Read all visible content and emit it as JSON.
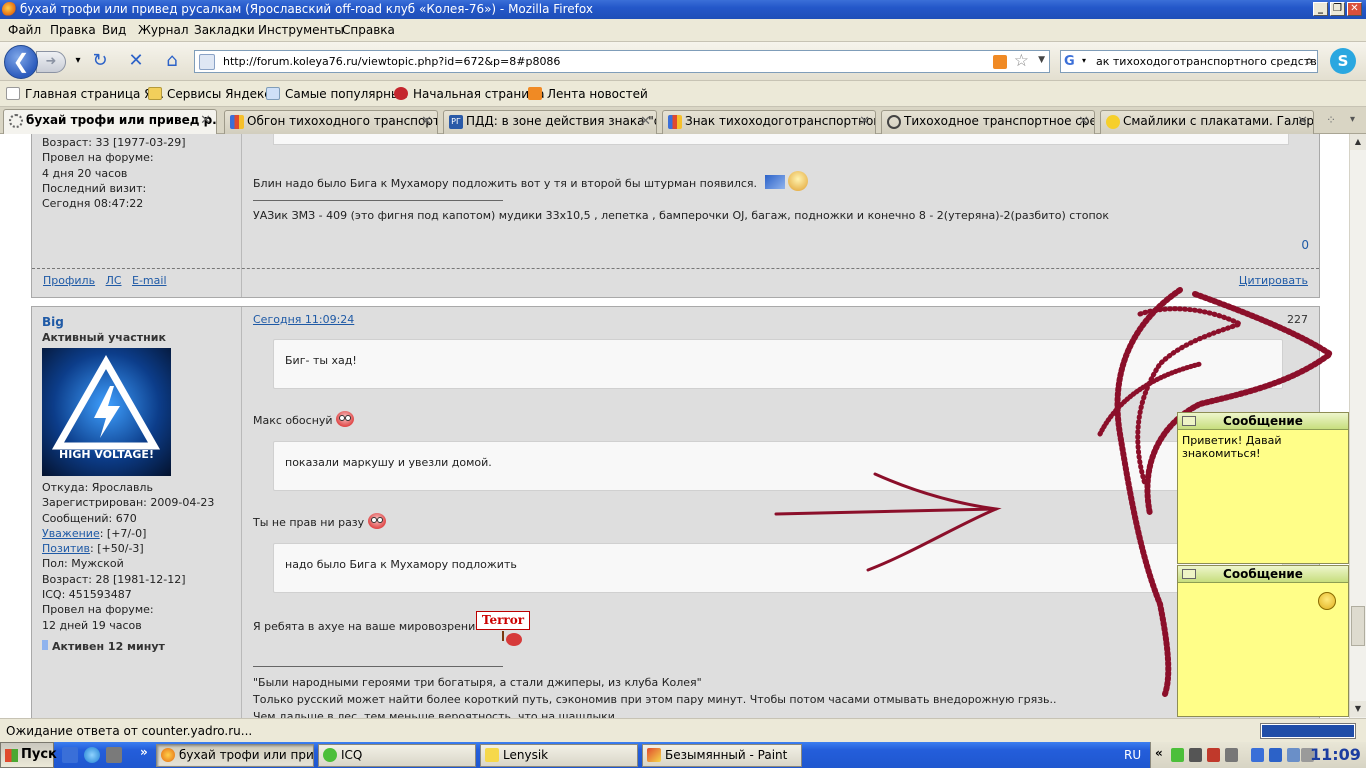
{
  "window": {
    "title": "бухай трофи или привед русалкам (Ярославский off-road клуб «Колея-76») - Mozilla Firefox"
  },
  "menu": [
    "Файл",
    "Правка",
    "Вид",
    "Журнал",
    "Закладки",
    "Инструменты",
    "Справка"
  ],
  "address": {
    "url": "http://forum.koleya76.ru/viewtopic.php?id=672&p=8#p8086",
    "search_text": "ак тихоходоготранспортного средства"
  },
  "bookmarks": [
    "Главная страница Я...",
    "Сервисы Яндекса",
    "Самые популярные",
    "Начальная страница",
    "Лента новостей"
  ],
  "tabs": [
    {
      "label": "бухай трофи или привед р..."
    },
    {
      "label": "Обгон тихоходного транспорт..."
    },
    {
      "label": "ПДД: в зоне действия знака \"о..."
    },
    {
      "label": "Знак тихоходоготранспортног..."
    },
    {
      "label": "Тихоходное транспортное сре..."
    },
    {
      "label": "Смайлики с плакатами. Галере..."
    }
  ],
  "post1": {
    "profile": [
      "Возраст: 33 [1977-03-29]",
      "Провел на форуме:",
      "4 дня 20 часов",
      "Последний визит:",
      "Сегодня 08:47:22"
    ],
    "message": "Блин надо было Бига к Мухамору подложить вот у тя и второй бы штурман появился.",
    "signature": "УАЗик ЗМЗ - 409 (это фигня под капотом) мудики 33х10,5 , лепетка , бамперочки OJ, багаж, подножки и конечно 8 - 2(утеряна)-2(разбито) стопок",
    "counter": "0",
    "links": {
      "profile": "Профиль",
      "pm": "ЛС",
      "email": "E-mail",
      "quote": "Цитировать"
    }
  },
  "post2": {
    "author": "Big",
    "rank": "Активный участник",
    "avatar_text": "HIGH VOLTAGE!",
    "from": "Откуда: Ярославль",
    "registered": "Зарегистрирован: 2009-04-23",
    "messages": "Сообщений: 670",
    "respect_label": "Уважение",
    "respect_value": ": [+7/-0]",
    "positive_label": "Позитив",
    "positive_value": ": [+50/-3]",
    "gender": "Пол: Мужской",
    "age": "Возраст: 28 [1981-12-12]",
    "icq": "ICQ: 451593487",
    "time_label": "Провел на форуме:",
    "time_value": "12 дней 19 часов",
    "active": "Активен 12 минут",
    "date": "Сегодня 11:09:24",
    "number": "227",
    "quote1": "Биг- ты хад!",
    "line1": "Макс обоснуй",
    "quote2": "показали маркушу и увезли домой.",
    "line2": "Ты не прав ни разу",
    "quote3": "надо было Бига к Мухамору подложить",
    "line3": "Я ребята в ахуе на ваше мировозрение",
    "terror_sign": "Terror",
    "sig1": "\"Были народными героями три богатыря, а стали джиперы, из клуба Колея\"",
    "sig2": "Только русский может найти более короткий путь, сэкономив при этом пару минут. Чтобы потом часами отмывать внедорожную грязь..",
    "sig3": "Чем дальше в лес, тем меньше вероятность, что на шашлыки..."
  },
  "chat": {
    "title1": "Сообщение",
    "text1": "Приветик! Давай знакомиться!",
    "title2": "Сообщение"
  },
  "status": {
    "text": "Ожидание ответа от counter.yadro.ru..."
  },
  "taskbar": {
    "start": "Пуск",
    "tasks": [
      "бухай трофи или прив...",
      "ICQ",
      "Lenysik",
      "Безымянный - Paint"
    ],
    "lang": "RU",
    "time": "11:09"
  },
  "colors": {
    "scribble": "#8b0f2a",
    "chat_bg": "#fffe88",
    "link": "#1f5aa6"
  }
}
